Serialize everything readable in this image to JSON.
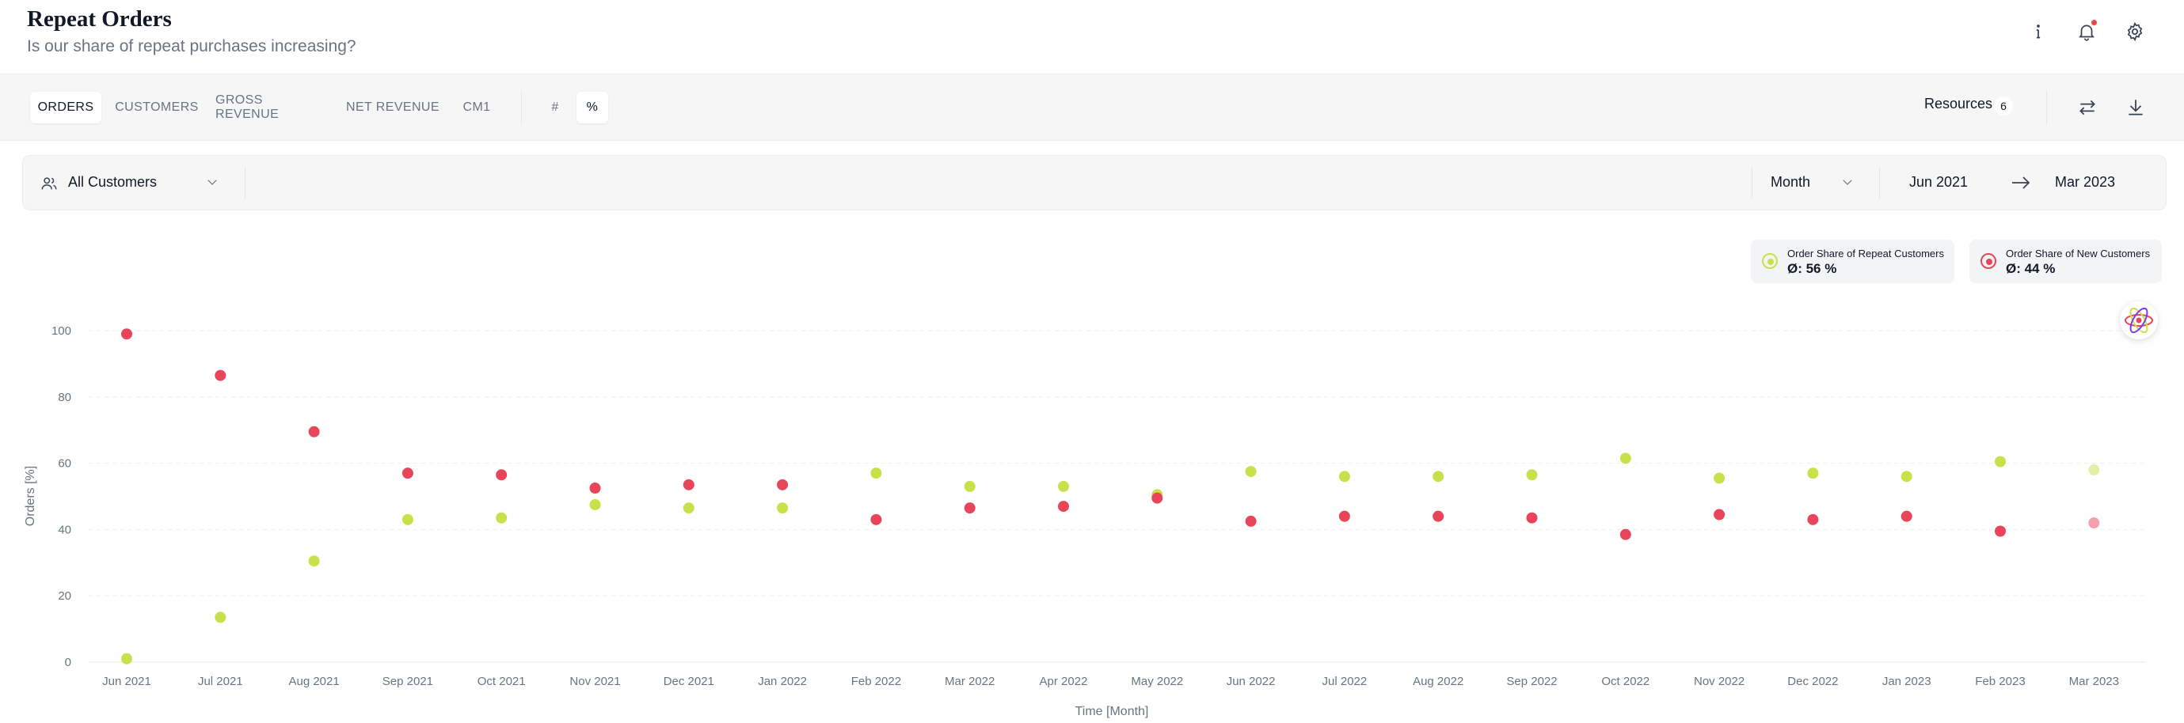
{
  "header": {
    "title": "Repeat Orders",
    "subtitle": "Is our share of repeat purchases increasing?",
    "icons": [
      "info-icon",
      "bell-icon",
      "gear-icon"
    ]
  },
  "tabs": {
    "metrics": [
      "ORDERS",
      "CUSTOMERS",
      "GROSS REVENUE",
      "NET REVENUE",
      "CM1"
    ],
    "active_metric": "ORDERS",
    "units": [
      "#",
      "%"
    ],
    "active_unit": "%",
    "resources_label": "Resources",
    "resources_count": "6",
    "icons": [
      "swap-icon",
      "download-icon"
    ]
  },
  "filters": {
    "segment": "All Customers",
    "granularity": "Month",
    "date_from": "Jun 2021",
    "date_to": "Mar 2023"
  },
  "legend": [
    {
      "name": "Order Share of Repeat Customers",
      "avg": "Ø: 56 %",
      "color": "#c8e04a"
    },
    {
      "name": "Order Share of New Customers",
      "avg": "Ø: 44 %",
      "color": "#e8455b"
    }
  ],
  "chart_data": {
    "type": "scatter",
    "xlabel": "Time [Month]",
    "ylabel": "Orders [%]",
    "ylim": [
      0,
      100
    ],
    "yticks": [
      0,
      20,
      40,
      60,
      80,
      100
    ],
    "categories": [
      "Jun 2021",
      "Jul 2021",
      "Aug 2021",
      "Sep 2021",
      "Oct 2021",
      "Nov 2021",
      "Dec 2021",
      "Jan 2022",
      "Feb 2022",
      "Mar 2022",
      "Apr 2022",
      "May 2022",
      "Jun 2022",
      "Jul 2022",
      "Aug 2022",
      "Sep 2022",
      "Oct 2022",
      "Nov 2022",
      "Dec 2022",
      "Jan 2023",
      "Feb 2023",
      "Mar 2023"
    ],
    "series": [
      {
        "name": "Order Share of Repeat Customers",
        "color": "#c8e04a",
        "values": [
          1,
          13.5,
          30.5,
          43,
          43.5,
          47.5,
          46.5,
          46.5,
          57,
          53,
          53,
          50.5,
          57.5,
          56,
          56,
          56.5,
          61.5,
          55.5,
          57,
          56,
          60.5,
          58
        ]
      },
      {
        "name": "Order Share of New Customers",
        "color": "#e8455b",
        "values": [
          99,
          86.5,
          69.5,
          57,
          56.5,
          52.5,
          53.5,
          53.5,
          43,
          46.5,
          47,
          49.5,
          42.5,
          44,
          44,
          43.5,
          38.5,
          44.5,
          43,
          44,
          39.5,
          42
        ]
      }
    ],
    "grid": true
  }
}
